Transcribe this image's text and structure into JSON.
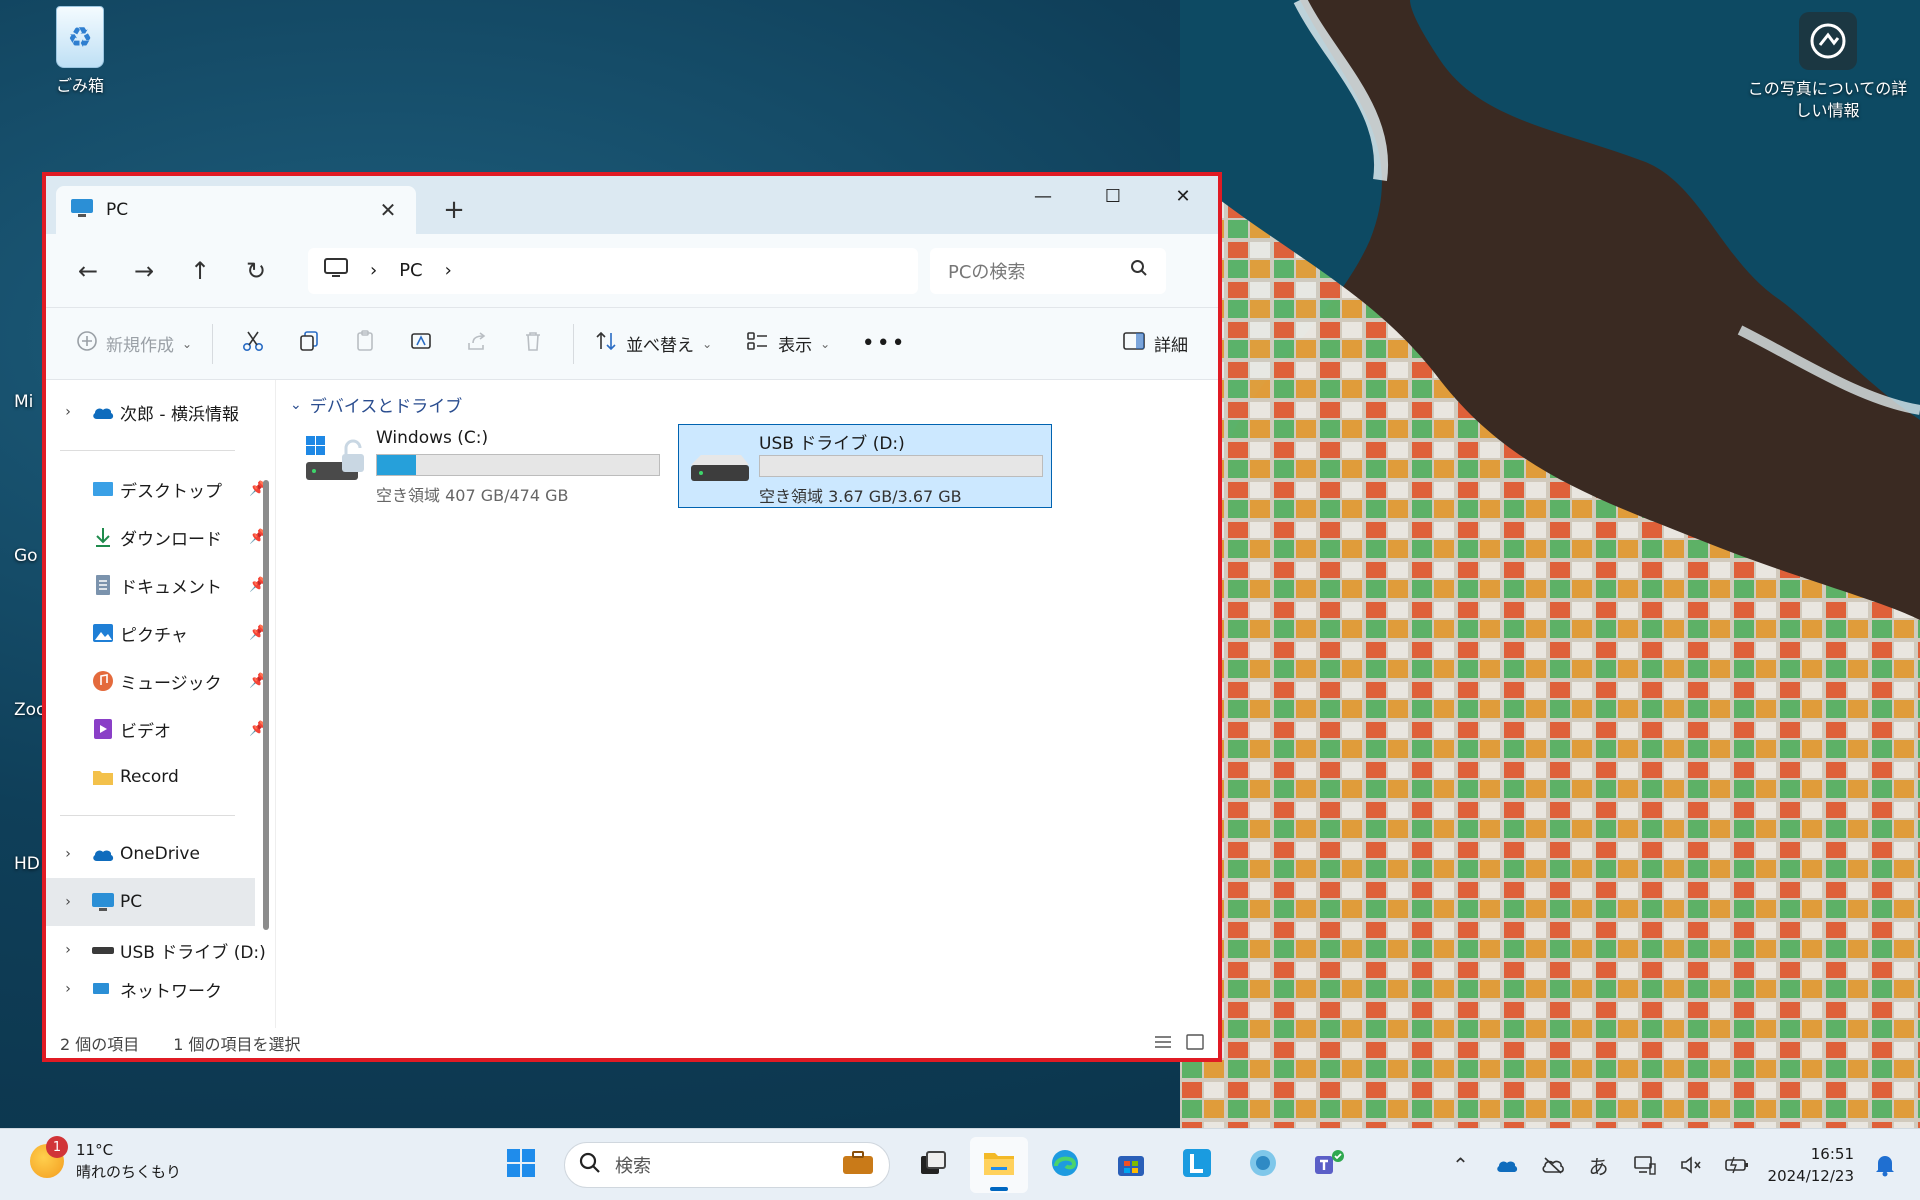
{
  "desktop": {
    "recycle_bin_label": "ごみ箱",
    "photo_info_label": "この写真についての詳しい情報",
    "partial_labels": [
      "Mi",
      "Go",
      "Zoo",
      "HD"
    ]
  },
  "window": {
    "tab_title": "PC",
    "address": {
      "crumbs": [
        "PC"
      ]
    },
    "search_placeholder": "PCの検索",
    "commands": {
      "new": "新規作成",
      "sort": "並べ替え",
      "view": "表示",
      "details": "詳細"
    },
    "sidebar": {
      "top_item": "次郎 - 横浜情報",
      "quick_access": [
        {
          "label": "デスクトップ",
          "icon": "desktop-icon",
          "pinned": true
        },
        {
          "label": "ダウンロード",
          "icon": "download-icon",
          "pinned": true
        },
        {
          "label": "ドキュメント",
          "icon": "document-icon",
          "pinned": true
        },
        {
          "label": "ピクチャ",
          "icon": "pictures-icon",
          "pinned": true
        },
        {
          "label": "ミュージック",
          "icon": "music-icon",
          "pinned": true
        },
        {
          "label": "ビデオ",
          "icon": "video-icon",
          "pinned": true
        },
        {
          "label": "Record",
          "icon": "folder-icon",
          "pinned": false
        }
      ],
      "locations": [
        {
          "label": "OneDrive",
          "icon": "onedrive-icon"
        },
        {
          "label": "PC",
          "icon": "pc-icon",
          "selected": true
        },
        {
          "label": "USB ドライブ (D:)",
          "icon": "usb-drive-icon"
        },
        {
          "label": "ネットワーク",
          "icon": "network-icon"
        }
      ]
    },
    "group_header": "デバイスとドライブ",
    "drives": [
      {
        "name": "Windows (C:)",
        "space": "空き領域 407 GB/474 GB",
        "used_fraction": 0.14,
        "selected": false
      },
      {
        "name": "USB ドライブ (D:)",
        "space": "空き領域 3.67 GB/3.67 GB",
        "used_fraction": 0.0,
        "selected": true
      }
    ],
    "status": {
      "item_count": "2 個の項目",
      "selection": "1 個の項目を選択"
    }
  },
  "taskbar": {
    "weather": {
      "temp": "11°C",
      "condition": "晴れのちくもり",
      "badge": "1"
    },
    "search_label": "検索",
    "ime": "あ",
    "time": "16:51",
    "date": "2024/12/23"
  },
  "colors": {
    "accent": "#0067c0",
    "window_border": "#e01b24",
    "selection": "#cce8ff",
    "bar_fill": "#26a0da"
  }
}
